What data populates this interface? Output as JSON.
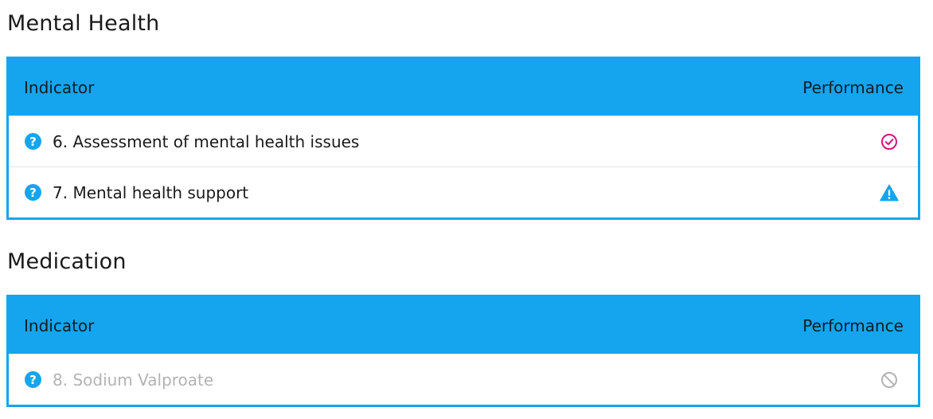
{
  "sections": [
    {
      "title": "Mental Health",
      "header": {
        "indicator": "Indicator",
        "performance": "Performance"
      },
      "rows": [
        {
          "label": "6. Assessment of mental health issues",
          "status_icon": "check-circle-icon"
        },
        {
          "label": "7. Mental health support",
          "status_icon": "warning-icon"
        }
      ]
    },
    {
      "title": "Medication",
      "header": {
        "indicator": "Indicator",
        "performance": "Performance"
      },
      "rows": [
        {
          "label": "8. Sodium Valproate",
          "status_icon": "not-applicable-icon"
        }
      ]
    }
  ],
  "colors": {
    "accent": "#14a5ee",
    "check": "#d0147f",
    "warning": "#14a5ee",
    "disabled": "#b3b3b3"
  }
}
